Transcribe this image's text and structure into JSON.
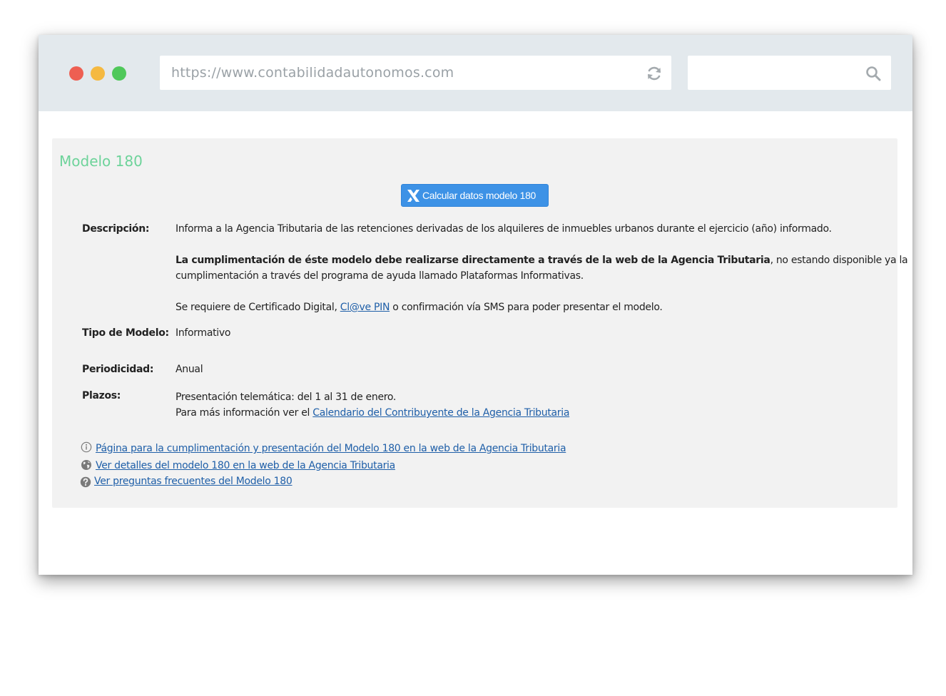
{
  "browser": {
    "url": "https://www.contabilidadautonomos.com",
    "reload_icon": "reload-icon",
    "search_icon": "search-icon"
  },
  "panel": {
    "title": "Modelo 180",
    "button_label": "Calcular datos modelo 180",
    "button_icon": "aeat-x-icon",
    "descripcion": {
      "label": "Descripción:",
      "line1": "Informa a la Agencia Tributaria de las retenciones derivadas de los alquileres de inmuebles urbanos durante el ejercicio (año) informado.",
      "line2_bold": "La cumplimentación de éste modelo debe realizarse directamente a través de la web de la Agencia Tributaria",
      "line2_rest": ", no estando disponible ya la",
      "line3": "cumplimentación a través del programa de ayuda llamado Plataformas Informativas.",
      "line4_pre": "Se requiere de Certificado Digital, ",
      "line4_link": "Cl@ve PIN",
      "line4_post": " o confirmación vía SMS para poder presentar el modelo."
    },
    "tipo": {
      "label": "Tipo de Modelo:",
      "value": "Informativo"
    },
    "periodicidad": {
      "label": "Periodicidad:",
      "value": "Anual"
    },
    "plazos": {
      "label": "Plazos:",
      "line1": "Presentación telemática: del 1 al 31 de enero.",
      "line2_pre": "Para más información ver el ",
      "line2_link": "Calendario del Contribuyente de la Agencia Tributaria"
    },
    "links": [
      {
        "icon": "info-icon",
        "text": "Página para la cumplimentación y presentación del Modelo 180 en la web de la Agencia Tributaria "
      },
      {
        "icon": "globe-icon",
        "text": "Ver detalles del modelo 180 en la web de la Agencia Tributaria "
      },
      {
        "icon": "question-icon",
        "text": "Ver preguntas frecuentes del Modelo 180 "
      }
    ]
  },
  "colors": {
    "title_green": "#6dd39a",
    "button_blue": "#3d92e6",
    "link_blue": "#1f5fa8",
    "titlebar": "#e3e9ed",
    "panel_bg": "#f2f2f2"
  }
}
